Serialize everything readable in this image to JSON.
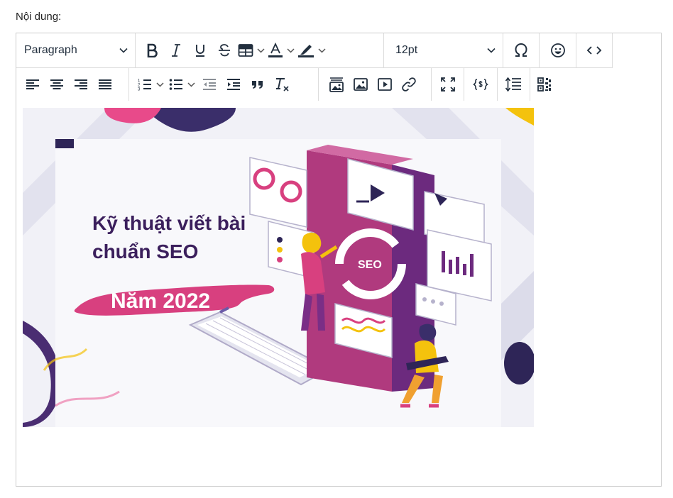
{
  "form": {
    "label": "Nội dung:"
  },
  "toolbar": {
    "block_format": "Paragraph",
    "font_size": "12pt",
    "row1_icons": [
      "bold-icon",
      "italic-icon",
      "underline-icon",
      "strikethrough-icon",
      "table-icon",
      "text-color-icon",
      "highlight-color-icon",
      "special-character-icon",
      "emoji-icon",
      "source-code-icon"
    ],
    "row2_icons": [
      "align-left-icon",
      "align-center-icon",
      "align-right-icon",
      "align-justify-icon",
      "numbered-list-icon",
      "bullet-list-icon",
      "outdent-icon",
      "indent-icon",
      "blockquote-icon",
      "clear-formatting-icon",
      "image-gallery-icon",
      "insert-image-icon",
      "insert-media-icon",
      "insert-link-icon",
      "fullscreen-icon",
      "template-variable-icon",
      "line-height-icon",
      "qr-code-icon"
    ],
    "colors": {
      "text_color_bar": "#222f3e",
      "highlight_bar": "#222f3e"
    }
  },
  "content": {
    "image": {
      "title_line1": "Kỹ thuật viết bài",
      "title_line2": "chuẩn SEO",
      "banner_text": "Năm 2022",
      "center_badge": "SEO",
      "colors": {
        "magenta": "#d8407f",
        "purple": "#7a2e86",
        "navy": "#2e2557",
        "yellow": "#f4c20d",
        "bg": "#ececf4"
      }
    }
  }
}
